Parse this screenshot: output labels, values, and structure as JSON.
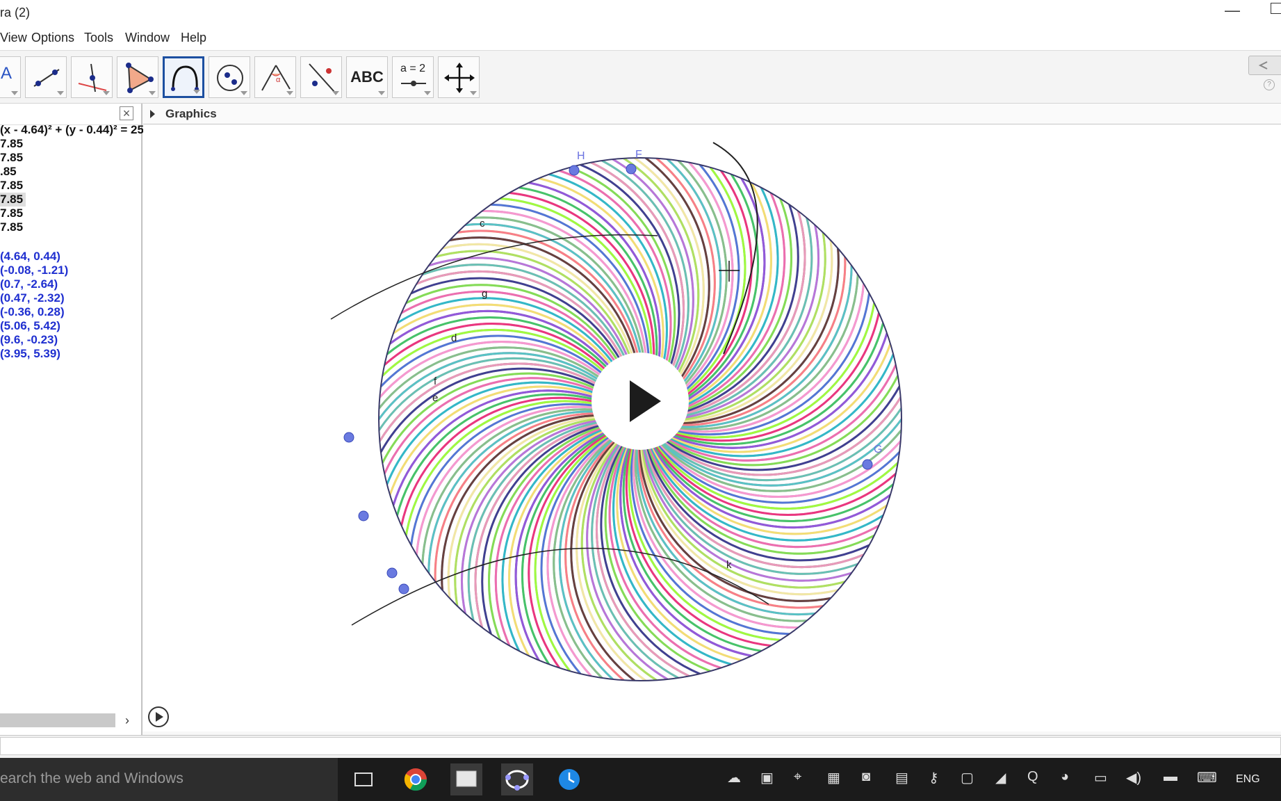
{
  "window": {
    "title": "ra (2)"
  },
  "menu": {
    "items": [
      "View",
      "Options",
      "Tools",
      "Window",
      "Help"
    ]
  },
  "toolbar": {
    "text_tool": "ABC",
    "slider_tool": "a = 2",
    "a_tool": "A",
    "selected_tool": "circular-arc-tool"
  },
  "algebra": {
    "rows": [
      {
        "text": "(x - 4.64)² + (y - 0.44)² = 25",
        "style": "black"
      },
      {
        "text": "7.85",
        "style": "black"
      },
      {
        "text": "7.85",
        "style": "black"
      },
      {
        "text": ".85",
        "style": "black"
      },
      {
        "text": "7.85",
        "style": "black"
      },
      {
        "text": "7.85",
        "style": "black",
        "highlight": true
      },
      {
        "text": "7.85",
        "style": "black"
      },
      {
        "text": "7.85",
        "style": "black"
      },
      {
        "text": "(4.64, 0.44)",
        "style": "blue"
      },
      {
        "text": "(-0.08, -1.21)",
        "style": "blue"
      },
      {
        "text": "(0.7, -2.64)",
        "style": "blue"
      },
      {
        "text": "(0.47, -2.32)",
        "style": "blue"
      },
      {
        "text": "(-0.36, 0.28)",
        "style": "blue"
      },
      {
        "text": "(5.06, 5.42)",
        "style": "blue"
      },
      {
        "text": "(9.6, -0.23)",
        "style": "blue"
      },
      {
        "text": "(3.95, 5.39)",
        "style": "blue"
      }
    ]
  },
  "graphics": {
    "title": "Graphics",
    "point_labels": {
      "H": "H",
      "F": "F",
      "G": "G"
    },
    "curve_labels": {
      "c": "c",
      "g": "g",
      "d": "d",
      "f": "f",
      "e": "e",
      "k": "k"
    },
    "palette": [
      "#e8307a",
      "#3fbf6b",
      "#9c5ce0",
      "#f2e36a",
      "#2fb5c9",
      "#ef6ea8",
      "#7ed957",
      "#2c2c8f",
      "#f4a3c8",
      "#58c9b7",
      "#c46ad8",
      "#b3e35b",
      "#eeeea0",
      "#6a3b2a",
      "#ff6f91",
      "#48d1cc",
      "#8fbc8f",
      "#ff9ecb",
      "#4169e1",
      "#adff2f"
    ]
  },
  "taskbar": {
    "search_placeholder": "earch the web and Windows",
    "lang": "ENG"
  }
}
